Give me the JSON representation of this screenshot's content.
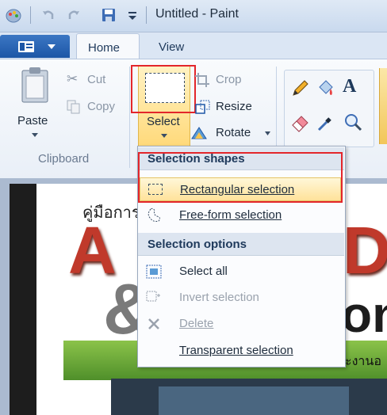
{
  "titlebar": {
    "title": "Untitled - Paint"
  },
  "tabs": {
    "file_label": "",
    "home": "Home",
    "view": "View"
  },
  "clipboard": {
    "paste": "Paste",
    "cut": "Cut",
    "copy": "Copy",
    "group": "Clipboard"
  },
  "image": {
    "select": "Select",
    "crop": "Crop",
    "resize": "Resize",
    "rotate": "Rotate"
  },
  "menu": {
    "header1": "Selection shapes",
    "rect": "Rectangular selection",
    "freeform": "Free-form selection",
    "header2": "Selection options",
    "select_all": "Select all",
    "invert": "Invert selection",
    "delete": "Delete",
    "transparent": "Transparent selection"
  },
  "canvas": {
    "text1": "คู่มือการ",
    "text2": "ะงานอ",
    "bigA": "A",
    "bigD": "D",
    "amp": "&",
    "on": "on"
  },
  "colors": {
    "accent": "#1c56a6",
    "highlight": "#e3262b"
  }
}
